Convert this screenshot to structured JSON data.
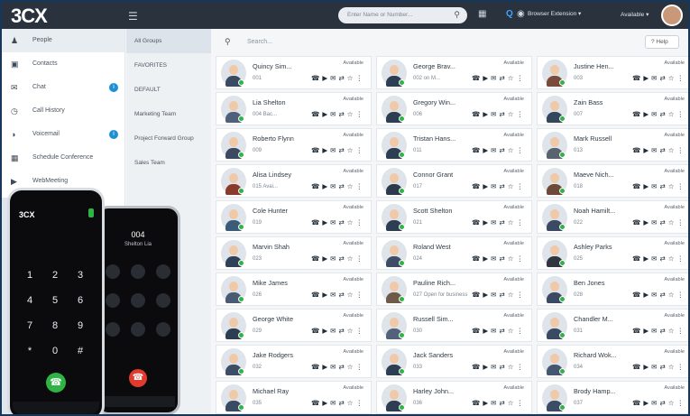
{
  "app": {
    "logo": "3CX"
  },
  "topbar": {
    "search_placeholder": "Enter Name or Number...",
    "extension_label": "Browser Extension",
    "status_label": "Available"
  },
  "sidebar": {
    "items": [
      {
        "label": "People",
        "icon": "person-icon",
        "badge": null
      },
      {
        "label": "Contacts",
        "icon": "contacts-icon",
        "badge": null
      },
      {
        "label": "Chat",
        "icon": "chat-icon",
        "badge": "i"
      },
      {
        "label": "Call History",
        "icon": "history-icon",
        "badge": null
      },
      {
        "label": "Voicemail",
        "icon": "voicemail-icon",
        "badge": "i"
      },
      {
        "label": "Schedule Conference",
        "icon": "calendar-icon",
        "badge": null
      },
      {
        "label": "WebMeeting",
        "icon": "video-icon",
        "badge": null
      }
    ]
  },
  "groups": [
    "All Groups",
    "FAVORITES",
    "DEFAULT",
    "Marketing Team",
    "Project Forward Group",
    "Sales Team"
  ],
  "main": {
    "search_placeholder": "Search...",
    "help_label": "Help"
  },
  "people": [
    {
      "name": "Quincy Sim...",
      "ext": "001",
      "status": "Available",
      "shirt": "#3a4a63"
    },
    {
      "name": "George Brav...",
      "ext": "002 on M...",
      "status": "Available",
      "shirt": "#2d3e53"
    },
    {
      "name": "Justine Hen...",
      "ext": "003",
      "status": "Available",
      "shirt": "#7a4b3a"
    },
    {
      "name": "Lia Shelton",
      "ext": "004 Bac...",
      "status": "Available",
      "shirt": "#51607a"
    },
    {
      "name": "Gregory Win...",
      "ext": "006",
      "status": "Available",
      "shirt": "#2d3e53"
    },
    {
      "name": "Zain Bass",
      "ext": "007",
      "status": "Available",
      "shirt": "#33465c"
    },
    {
      "name": "Roberto Flynn",
      "ext": "009",
      "status": "Available",
      "shirt": "#3b4a60"
    },
    {
      "name": "Tristan Hans...",
      "ext": "011",
      "status": "Available",
      "shirt": "#2d3e53"
    },
    {
      "name": "Mark Russell",
      "ext": "013",
      "status": "Available",
      "shirt": "#58636f"
    },
    {
      "name": "Alisa Lindsey",
      "ext": "015 Avai...",
      "status": "Available",
      "shirt": "#8a3b2d"
    },
    {
      "name": "Connor Grant",
      "ext": "017",
      "status": "Available",
      "shirt": "#2c3a4e"
    },
    {
      "name": "Maeve Nich...",
      "ext": "018",
      "status": "Available",
      "shirt": "#6b4a3a"
    },
    {
      "name": "Cole Hunter",
      "ext": "019",
      "status": "Available",
      "shirt": "#3c5b79"
    },
    {
      "name": "Scott Shelton",
      "ext": "021",
      "status": "Available",
      "shirt": "#2d3e53"
    },
    {
      "name": "Noah Hamilt...",
      "ext": "022",
      "status": "Available",
      "shirt": "#3a4a63"
    },
    {
      "name": "Marvin Shah",
      "ext": "023",
      "status": "Available",
      "shirt": "#2f4057"
    },
    {
      "name": "Roland West",
      "ext": "024",
      "status": "Available",
      "shirt": "#3d4d65"
    },
    {
      "name": "Ashley Parks",
      "ext": "025",
      "status": "Available",
      "shirt": "#30363f"
    },
    {
      "name": "Mike James",
      "ext": "026",
      "status": "Available",
      "shirt": "#4a5a72"
    },
    {
      "name": "Pauline Rich...",
      "ext": "027 Open for business",
      "status": "Available",
      "shirt": "#6e5a4a"
    },
    {
      "name": "Ben Jones",
      "ext": "028",
      "status": "Available",
      "shirt": "#3a4a63"
    },
    {
      "name": "George White",
      "ext": "029",
      "status": "Available",
      "shirt": "#2d3e53"
    },
    {
      "name": "Russell Sim...",
      "ext": "030",
      "status": "Available",
      "shirt": "#52627a"
    },
    {
      "name": "Chandler M...",
      "ext": "031",
      "status": "Available",
      "shirt": "#3a4a63"
    },
    {
      "name": "Jake Rodgers",
      "ext": "032",
      "status": "Available",
      "shirt": "#3d4d65"
    },
    {
      "name": "Jack Sanders",
      "ext": "033",
      "status": "Available",
      "shirt": "#2d3e53"
    },
    {
      "name": "Richard Wok...",
      "ext": "034",
      "status": "Available",
      "shirt": "#445670"
    },
    {
      "name": "Michael Ray",
      "ext": "035",
      "status": "Available",
      "shirt": "#3a4a63"
    },
    {
      "name": "Harley John...",
      "ext": "036",
      "status": "Available",
      "shirt": "#2d3e53"
    },
    {
      "name": "Brody Hamp...",
      "ext": "037",
      "status": "Available",
      "shirt": "#3c4c64"
    }
  ],
  "phones": {
    "phone1": {
      "logo": "3CX",
      "keys": [
        "1",
        "2",
        "3",
        "4",
        "5",
        "6",
        "7",
        "8",
        "9",
        "*",
        "0",
        "#"
      ]
    },
    "phone2": {
      "number": "004",
      "name": "Shelton Lia"
    }
  }
}
